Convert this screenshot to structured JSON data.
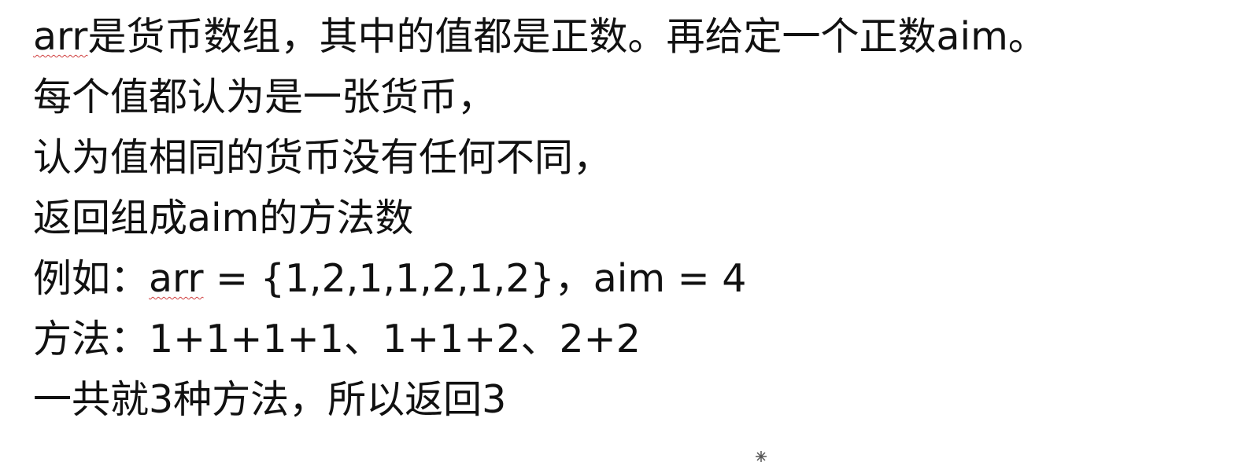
{
  "document": {
    "lines": [
      {
        "squiggle": "arr",
        "text": "是货币数组，其中的值都是正数。再给定一个正数aim。"
      },
      {
        "squiggle": "",
        "text": "每个值都认为是一张货币，"
      },
      {
        "squiggle": "",
        "text": "认为值相同的货币没有任何不同，"
      },
      {
        "squiggle": "",
        "text": "返回组成aim的方法数"
      },
      {
        "prefix": "例如：",
        "squiggle": "arr",
        "text": " = {1,2,1,1,2,1,2}，aim = 4"
      },
      {
        "squiggle": "",
        "text": "方法：1+1+1+1、1+1+2、2+2"
      },
      {
        "squiggle": "",
        "text": "一共就3种方法，所以返回3"
      }
    ]
  }
}
